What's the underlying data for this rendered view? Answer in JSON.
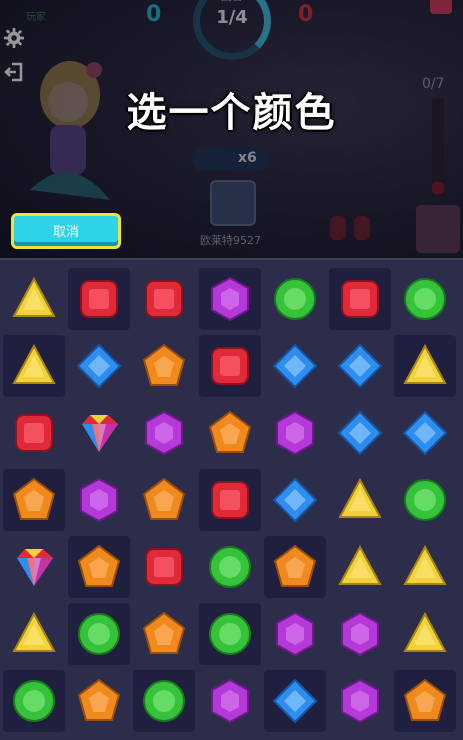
{
  "hud": {
    "player_name": "玩家",
    "score_left": "0",
    "score_right": "0",
    "round_label": "回合",
    "round_value": "1/4",
    "progress": "0/7",
    "multiplier": "x6",
    "opponent": "欧莱特9527"
  },
  "prompt": {
    "title": "选一个颜色"
  },
  "buttons": {
    "cancel": "取消"
  },
  "board": {
    "rows": [
      [
        "yellow",
        "red",
        "red",
        "purple",
        "green",
        "red",
        "green"
      ],
      [
        "yellow",
        "blue",
        "orange",
        "red",
        "blue",
        "blue",
        "yellow"
      ],
      [
        "red",
        "rainbow",
        "purple",
        "orange",
        "purple",
        "blue",
        "blue"
      ],
      [
        "orange",
        "purple",
        "orange",
        "red",
        "blue",
        "yellow",
        "green"
      ],
      [
        "rainbow",
        "orange",
        "red",
        "green",
        "orange",
        "yellow",
        "yellow"
      ],
      [
        "yellow",
        "green",
        "orange",
        "green",
        "purple",
        "purple",
        "yellow"
      ],
      [
        "green",
        "orange",
        "green",
        "purple",
        "blue",
        "purple",
        "orange"
      ]
    ],
    "dark_cells": [
      [
        1,
        3,
        5
      ],
      [
        0,
        3,
        6
      ],
      [],
      [
        0,
        3
      ],
      [
        1,
        4
      ],
      [
        1,
        3
      ],
      [
        0,
        2,
        4,
        6
      ]
    ]
  },
  "colors": {
    "yellow": "#f2d23a",
    "red": "#e02a3a",
    "purple": "#b538d8",
    "green": "#36c23a",
    "blue": "#2e8ef0",
    "orange": "#f08a1e"
  }
}
